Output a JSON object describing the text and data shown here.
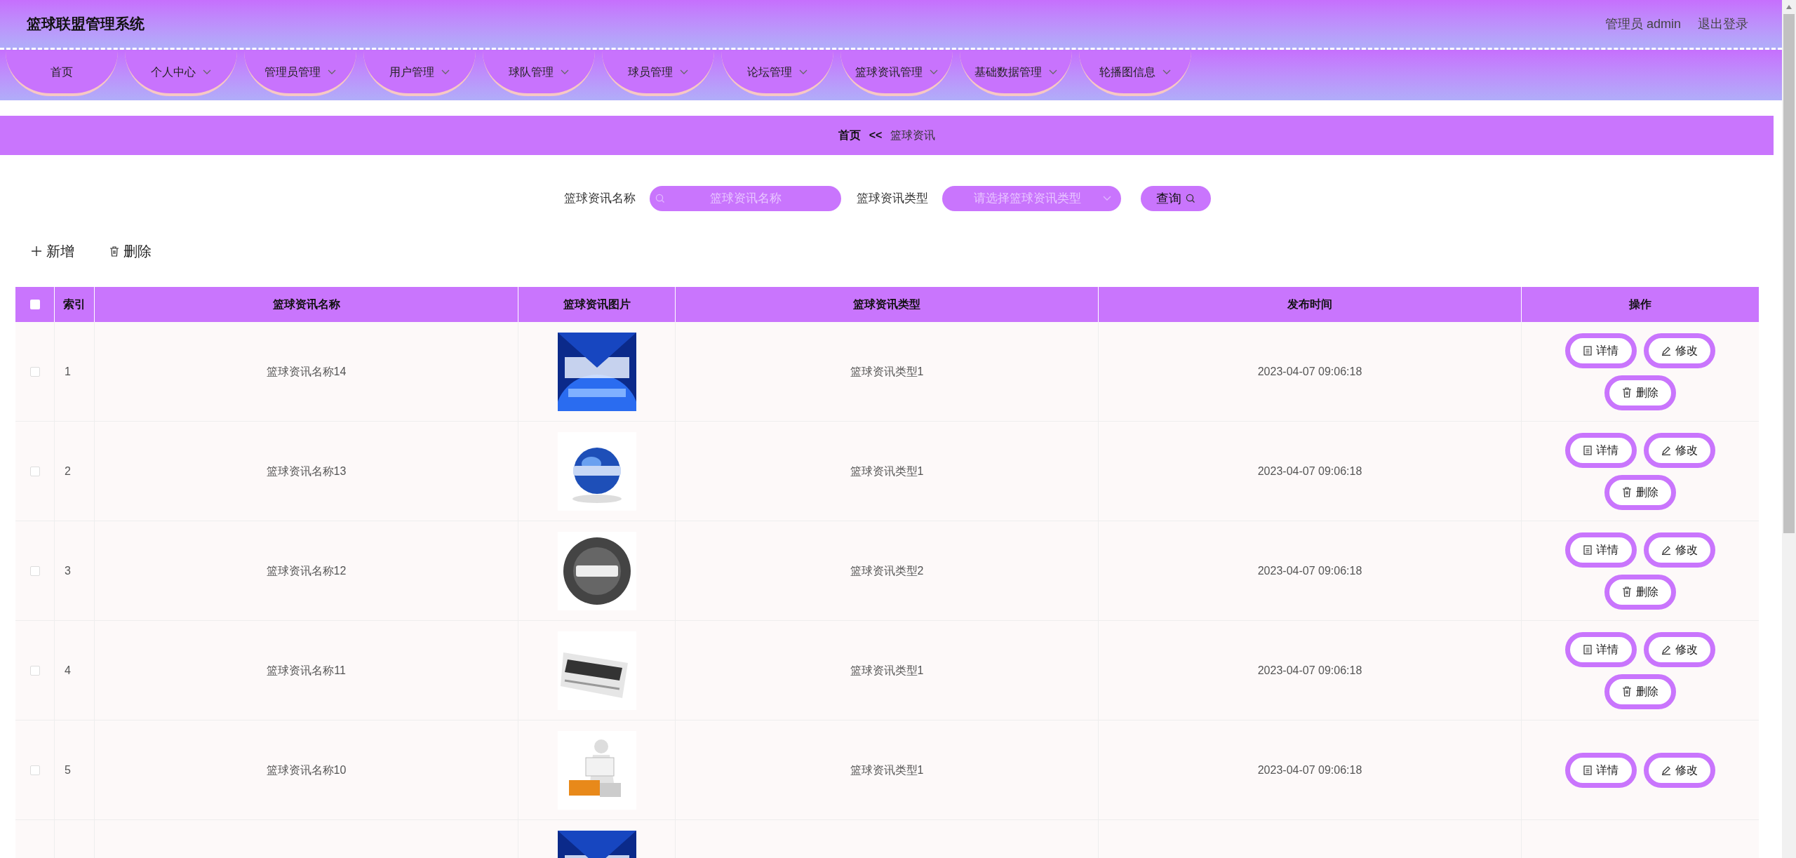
{
  "header": {
    "title": "篮球联盟管理系统",
    "user": "管理员 admin",
    "logout": "退出登录"
  },
  "nav": [
    {
      "label": "首页",
      "dropdown": false
    },
    {
      "label": "个人中心",
      "dropdown": true
    },
    {
      "label": "管理员管理",
      "dropdown": true
    },
    {
      "label": "用户管理",
      "dropdown": true
    },
    {
      "label": "球队管理",
      "dropdown": true
    },
    {
      "label": "球员管理",
      "dropdown": true
    },
    {
      "label": "论坛管理",
      "dropdown": true
    },
    {
      "label": "篮球资讯管理",
      "dropdown": true
    },
    {
      "label": "基础数据管理",
      "dropdown": true
    },
    {
      "label": "轮播图信息",
      "dropdown": true
    }
  ],
  "breadcrumb": {
    "home": "首页",
    "separator": "<<",
    "current": "篮球资讯"
  },
  "search": {
    "name_label": "篮球资讯名称",
    "name_placeholder": "篮球资讯名称",
    "type_label": "篮球资讯类型",
    "type_placeholder": "请选择篮球资讯类型",
    "button": "查询"
  },
  "toolbar": {
    "add": "新增",
    "delete": "删除"
  },
  "table": {
    "select_all_checked": false,
    "columns": [
      "索引",
      "篮球资讯名称",
      "篮球资讯图片",
      "篮球资讯类型",
      "发布时间",
      "操作"
    ],
    "rows": [
      {
        "checked": false,
        "index": "1",
        "name": "篮球资讯名称14",
        "image": {
          "kind": "picture"
        },
        "type": "篮球资讯类型1",
        "time": "2023-04-07 09:06:18",
        "actions": [
          {
            "kind": "detail",
            "label": "详情"
          },
          {
            "kind": "edit",
            "label": "修改"
          },
          {
            "kind": "delete",
            "label": "删除"
          }
        ]
      },
      {
        "checked": false,
        "index": "2",
        "name": "篮球资讯名称13",
        "image": {
          "kind": "picture"
        },
        "type": "篮球资讯类型1",
        "time": "2023-04-07 09:06:18",
        "actions": [
          {
            "kind": "detail",
            "label": "详情"
          },
          {
            "kind": "edit",
            "label": "修改"
          },
          {
            "kind": "delete",
            "label": "删除"
          }
        ]
      },
      {
        "checked": false,
        "index": "3",
        "name": "篮球资讯名称12",
        "image": {
          "kind": "picture"
        },
        "type": "篮球资讯类型2",
        "time": "2023-04-07 09:06:18",
        "actions": [
          {
            "kind": "detail",
            "label": "详情"
          },
          {
            "kind": "edit",
            "label": "修改"
          },
          {
            "kind": "delete",
            "label": "删除"
          }
        ]
      },
      {
        "checked": false,
        "index": "4",
        "name": "篮球资讯名称11",
        "image": {
          "kind": "picture"
        },
        "type": "篮球资讯类型1",
        "time": "2023-04-07 09:06:18",
        "actions": [
          {
            "kind": "detail",
            "label": "详情"
          },
          {
            "kind": "edit",
            "label": "修改"
          },
          {
            "kind": "delete",
            "label": "删除"
          }
        ]
      },
      {
        "checked": false,
        "index": "5",
        "name": "篮球资讯名称10",
        "image": {
          "kind": "picture"
        },
        "type": "篮球资讯类型1",
        "time": "2023-04-07 09:06:18",
        "actions": [
          {
            "kind": "detail",
            "label": "详情"
          },
          {
            "kind": "edit",
            "label": "修改"
          }
        ]
      },
      {
        "image": {
          "kind": "picture"
        }
      }
    ]
  }
}
